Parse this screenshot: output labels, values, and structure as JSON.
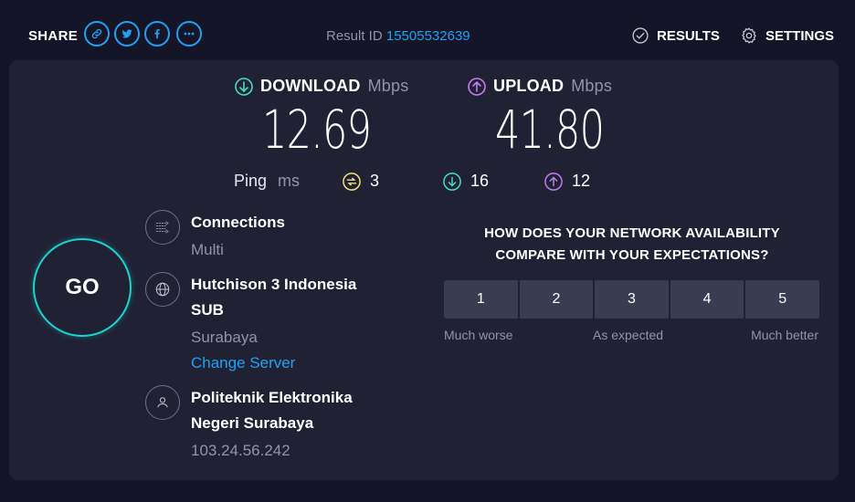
{
  "header": {
    "share_label": "SHARE",
    "share_buttons": [
      {
        "icon": "link-icon"
      },
      {
        "icon": "twitter-icon"
      },
      {
        "icon": "facebook-icon"
      },
      {
        "icon": "more-icon"
      }
    ],
    "result_id_label": "Result ID",
    "result_id_value": "15505532639",
    "results_label": "RESULTS",
    "settings_label": "SETTINGS"
  },
  "download": {
    "label": "DOWNLOAD",
    "unit": "Mbps",
    "value": "12.69",
    "color": "#3fe0c5"
  },
  "upload": {
    "label": "UPLOAD",
    "unit": "Mbps",
    "value": "41.80",
    "color": "#c27cf5"
  },
  "ping": {
    "label": "Ping",
    "unit": "ms",
    "idle": "3",
    "download": "16",
    "upload": "12",
    "idle_color": "#f7e37a"
  },
  "go_label": "GO",
  "connections": {
    "title": "Connections",
    "value": "Multi"
  },
  "server": {
    "title": "Hutchison 3 Indonesia SUB",
    "location": "Surabaya",
    "change_label": "Change Server"
  },
  "provider": {
    "title": "Politeknik Elektronika Negeri Surabaya",
    "ip": "103.24.56.242"
  },
  "survey": {
    "question": "HOW DOES YOUR NETWORK AVAILABILITY COMPARE WITH YOUR EXPECTATIONS?",
    "options": [
      "1",
      "2",
      "3",
      "4",
      "5"
    ],
    "label_low": "Much worse",
    "label_mid": "As expected",
    "label_high": "Much better"
  },
  "colors": {
    "accent": "#1ea1f5",
    "go_ring": "#1bd3d0",
    "background": "#141526",
    "card": "#202234"
  }
}
